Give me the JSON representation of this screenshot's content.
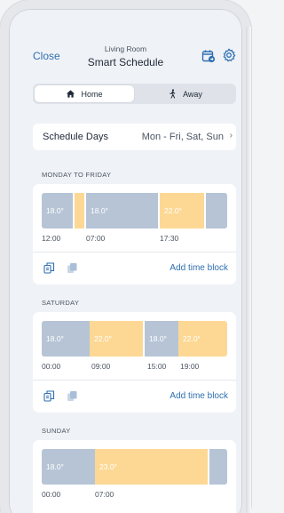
{
  "header": {
    "close_label": "Close",
    "room": "Living Room",
    "title": "Smart Schedule",
    "calendar_icon": "calendar-icon",
    "settings_icon": "gear-icon"
  },
  "mode_tabs": {
    "home_label": "Home",
    "away_label": "Away",
    "selected": "Home"
  },
  "schedule_days": {
    "label": "Schedule Days",
    "value": "Mon - Fri, Sat, Sun"
  },
  "colors": {
    "accent": "#2f6fb0",
    "cool_block": "#b6c4d6",
    "warm_block": "#fdd894"
  },
  "sections": [
    {
      "label": "MONDAY TO FRIDAY",
      "blocks": [
        {
          "temp": "18.0°",
          "type": "cool"
        },
        {
          "temp": "",
          "type": "warm"
        },
        {
          "temp": "18.0°",
          "type": "cool"
        },
        {
          "temp": "22.0°",
          "type": "warm"
        },
        {
          "temp": "",
          "type": "cool"
        }
      ],
      "times": [
        "12:00",
        "07:00",
        "17:30"
      ],
      "add_label": "Add time block"
    },
    {
      "label": "SATURDAY",
      "blocks": [
        {
          "temp": "18.0°",
          "type": "cool"
        },
        {
          "temp": "22.0°",
          "type": "warm"
        },
        {
          "temp": "18.0°",
          "type": "cool"
        },
        {
          "temp": "22.0°",
          "type": "warm"
        }
      ],
      "times": [
        "00:00",
        "09:00",
        "15:00",
        "19:00"
      ],
      "add_label": "Add time block"
    },
    {
      "label": "SUNDAY",
      "blocks": [
        {
          "temp": "18.0°",
          "type": "cool"
        },
        {
          "temp": "23.0°",
          "type": "warm"
        },
        {
          "temp": "",
          "type": "cool"
        }
      ],
      "times": [
        "00:00",
        "07:00"
      ]
    }
  ]
}
